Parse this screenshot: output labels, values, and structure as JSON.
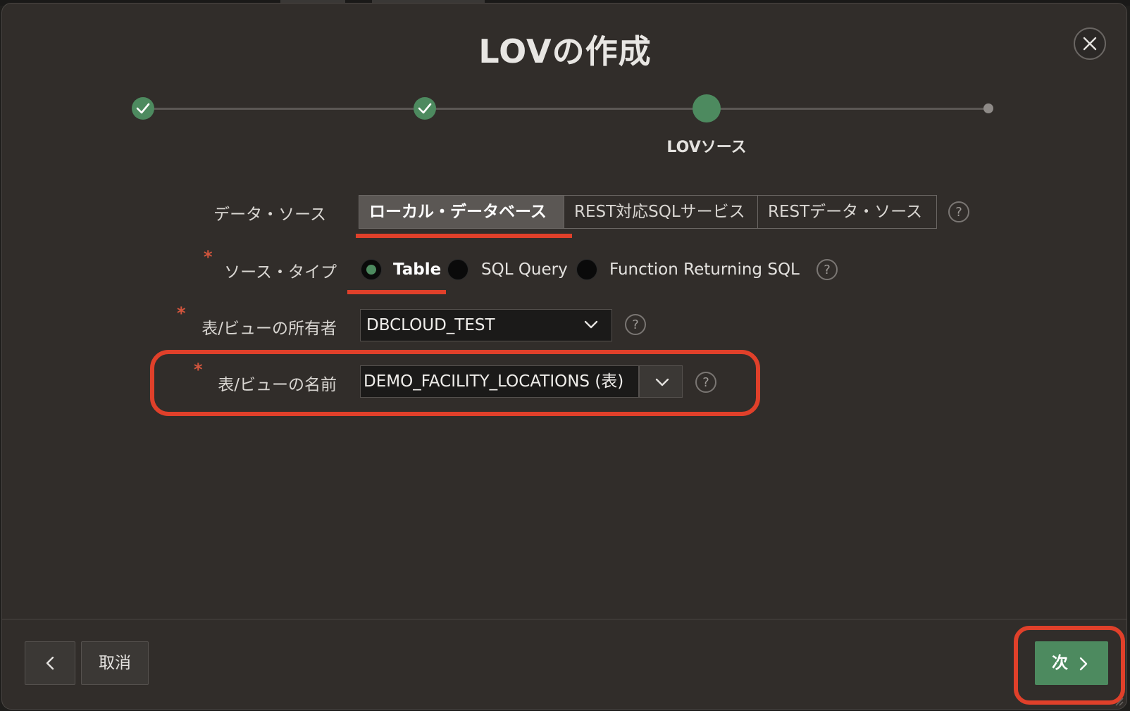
{
  "dialog": {
    "title": "LOVの作成",
    "close_icon": "close-icon"
  },
  "progress": {
    "steps": [
      {
        "state": "done"
      },
      {
        "state": "done"
      },
      {
        "state": "current",
        "label": "LOVソース"
      },
      {
        "state": "future"
      }
    ]
  },
  "form": {
    "data_source": {
      "label": "データ・ソース",
      "options": [
        "ローカル・データベース",
        "REST対応SQLサービス",
        "RESTデータ・ソース"
      ],
      "selected": "ローカル・データベース",
      "help": "?"
    },
    "source_type": {
      "label": "ソース・タイプ",
      "required": "*",
      "options": [
        "Table",
        "SQL Query",
        "Function Returning SQL"
      ],
      "selected": "Table",
      "help": "?"
    },
    "owner": {
      "label": "表/ビューの所有者",
      "required": "*",
      "value": "DBCLOUD_TEST",
      "help": "?"
    },
    "table_name": {
      "label": "表/ビューの名前",
      "required": "*",
      "value": "DEMO_FACILITY_LOCATIONS (表)",
      "help": "?"
    }
  },
  "footer": {
    "back_icon": "chevron-left-icon",
    "cancel_label": "取消",
    "next_label": "次"
  },
  "colors": {
    "dialog_bg": "#312d2a",
    "accent_green": "#4d8a5f",
    "annotation_red": "#e0402a"
  }
}
